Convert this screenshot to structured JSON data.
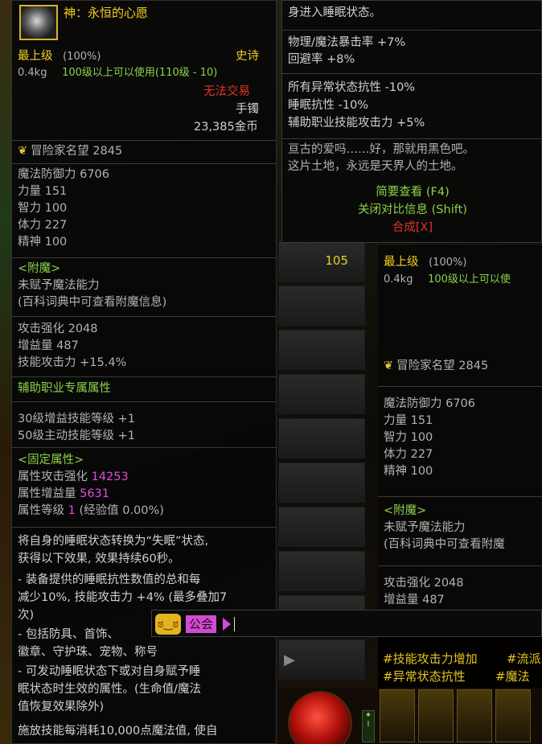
{
  "left_tooltip": {
    "item_name": "神：永恒的心愿",
    "grade": "最上级",
    "grade_pct": "(100%)",
    "rarity": "史诗",
    "weight": "0.4kg",
    "level_req": "100级以上可以使用(110级 - 10)",
    "trade": "无法交易",
    "slot_type": "手镯",
    "price": "23,385金币",
    "reputation": "冒险家名望 2845",
    "stats": [
      "魔法防御力 6706",
      "力量 151",
      "智力 100",
      "体力 227",
      "精神 100"
    ],
    "enchant_title": "<附魔>",
    "enchant_line1": "未赋予魔法能力",
    "enchant_line2": "(百科词典中可查看附魔信息)",
    "attack_lines": [
      "攻击强化 2048",
      "增益量 487",
      "技能攻击力 +15.4%"
    ],
    "support_title": "辅助职业专属属性",
    "support_lines": [
      "30级增益技能等级 +1",
      "50级主动技能等级 +1"
    ],
    "fixed_title": "<固定属性>",
    "fixed_label1": "属性攻击强化 ",
    "fixed_val1": "14253",
    "fixed_label2": "属性增益量 ",
    "fixed_val2": "5631",
    "fixed_label3": "属性等级 ",
    "fixed_val3": "1",
    "fixed_rest3": " (经验值 0.00%)",
    "desc_lines": [
      "将自身的睡眠状态转换为“失眠”状态,",
      "获得以下效果, 效果持续60秒。",
      "- 装备提供的睡眠抗性数值的总和每",
      "减少10%, 技能攻击力 +4% (最多叠加7",
      "次)",
      "- 包括防具、首饰、",
      "徽章、守护珠、宠物、称号",
      "- 可发动睡眠状态下或对自身赋予睡",
      "眠状态时生效的属性。(生命值/魔法",
      "值恢复效果除外)",
      "施放技能每消耗10,000点魔法值, 使自"
    ]
  },
  "right_tooltip_top": {
    "line0": "身进入睡眠状态。",
    "lines": [
      "物理/魔法暴击率 +7%",
      "回避率 +8%",
      "所有异常状态抗性 -10%",
      "睡眠抗性 -10%",
      "辅助职业技能攻击力 +5%"
    ],
    "flavor1": "亘古的爱吗……好，那就用黑色吧。",
    "flavor2": "这片土地，永远是天界人的土地。",
    "brief_view": "简要查看 (F4)",
    "close_compare": "关闭对比信息 (Shift)",
    "compose": "合成[X]"
  },
  "middle_slot": {
    "number": "105"
  },
  "right_tooltip_bottom": {
    "grade": "最上级",
    "grade_pct": "(100%)",
    "weight": "0.4kg",
    "level_req": "100级以上可以使",
    "reputation": "冒险家名望 2845",
    "stats": [
      "魔法防御力 6706",
      "力量 151",
      "智力 100",
      "体力 227",
      "精神 100"
    ],
    "enchant_title": "<附魔>",
    "enchant_line1": "未赋予魔法能力",
    "enchant_line2": "(百科词典中可查看附魔",
    "attack_lines": [
      "攻击强化 2048",
      "增益量 487"
    ]
  },
  "chat": {
    "channel": "公会"
  },
  "skill_labels": {
    "l1": "#技能攻击力增加",
    "l2": "#流派",
    "l3": "#异常状态抗性",
    "l4": "#魔法"
  },
  "colors": {
    "gold": "#f3d11c",
    "green": "#8cd24a",
    "red": "#e0322a",
    "magenta": "#e24bd6"
  }
}
